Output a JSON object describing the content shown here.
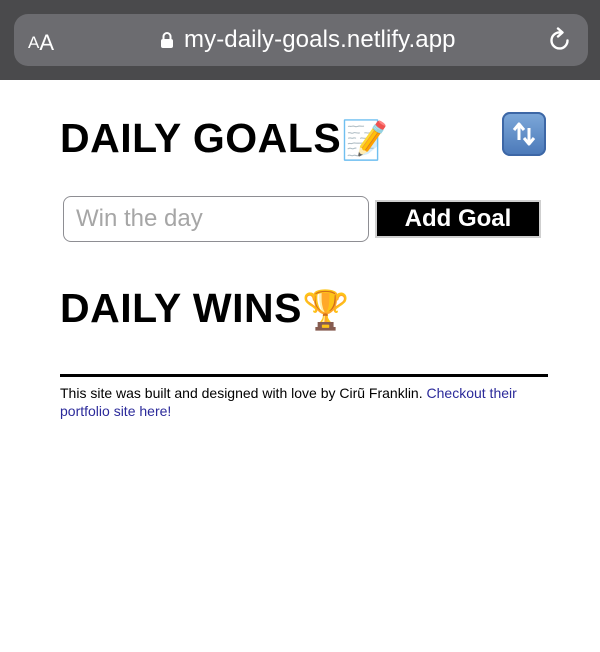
{
  "browser": {
    "text_size_small": "A",
    "text_size_big": "A",
    "url": "my-daily-goals.netlify.app",
    "icons": {
      "lock": "lock-icon",
      "reload": "reload-icon"
    }
  },
  "header": {
    "title": "DAILY GOALS",
    "title_emoji": "📝",
    "refresh_icon": "🔃"
  },
  "goal_form": {
    "placeholder": "Win the day",
    "value": "",
    "add_button_label": "Add Goal"
  },
  "wins": {
    "title": "DAILY WINS",
    "title_emoji": "🏆",
    "items": []
  },
  "footer": {
    "text": "This site was built and designed with love by Cirũ Franklin. ",
    "link_text": "Checkout their portfolio site here!"
  },
  "colors": {
    "browser_bar": "#4a4a4c",
    "address_pill": "#6c6c70",
    "button_bg": "#000000",
    "link": "#2b2a9a"
  }
}
